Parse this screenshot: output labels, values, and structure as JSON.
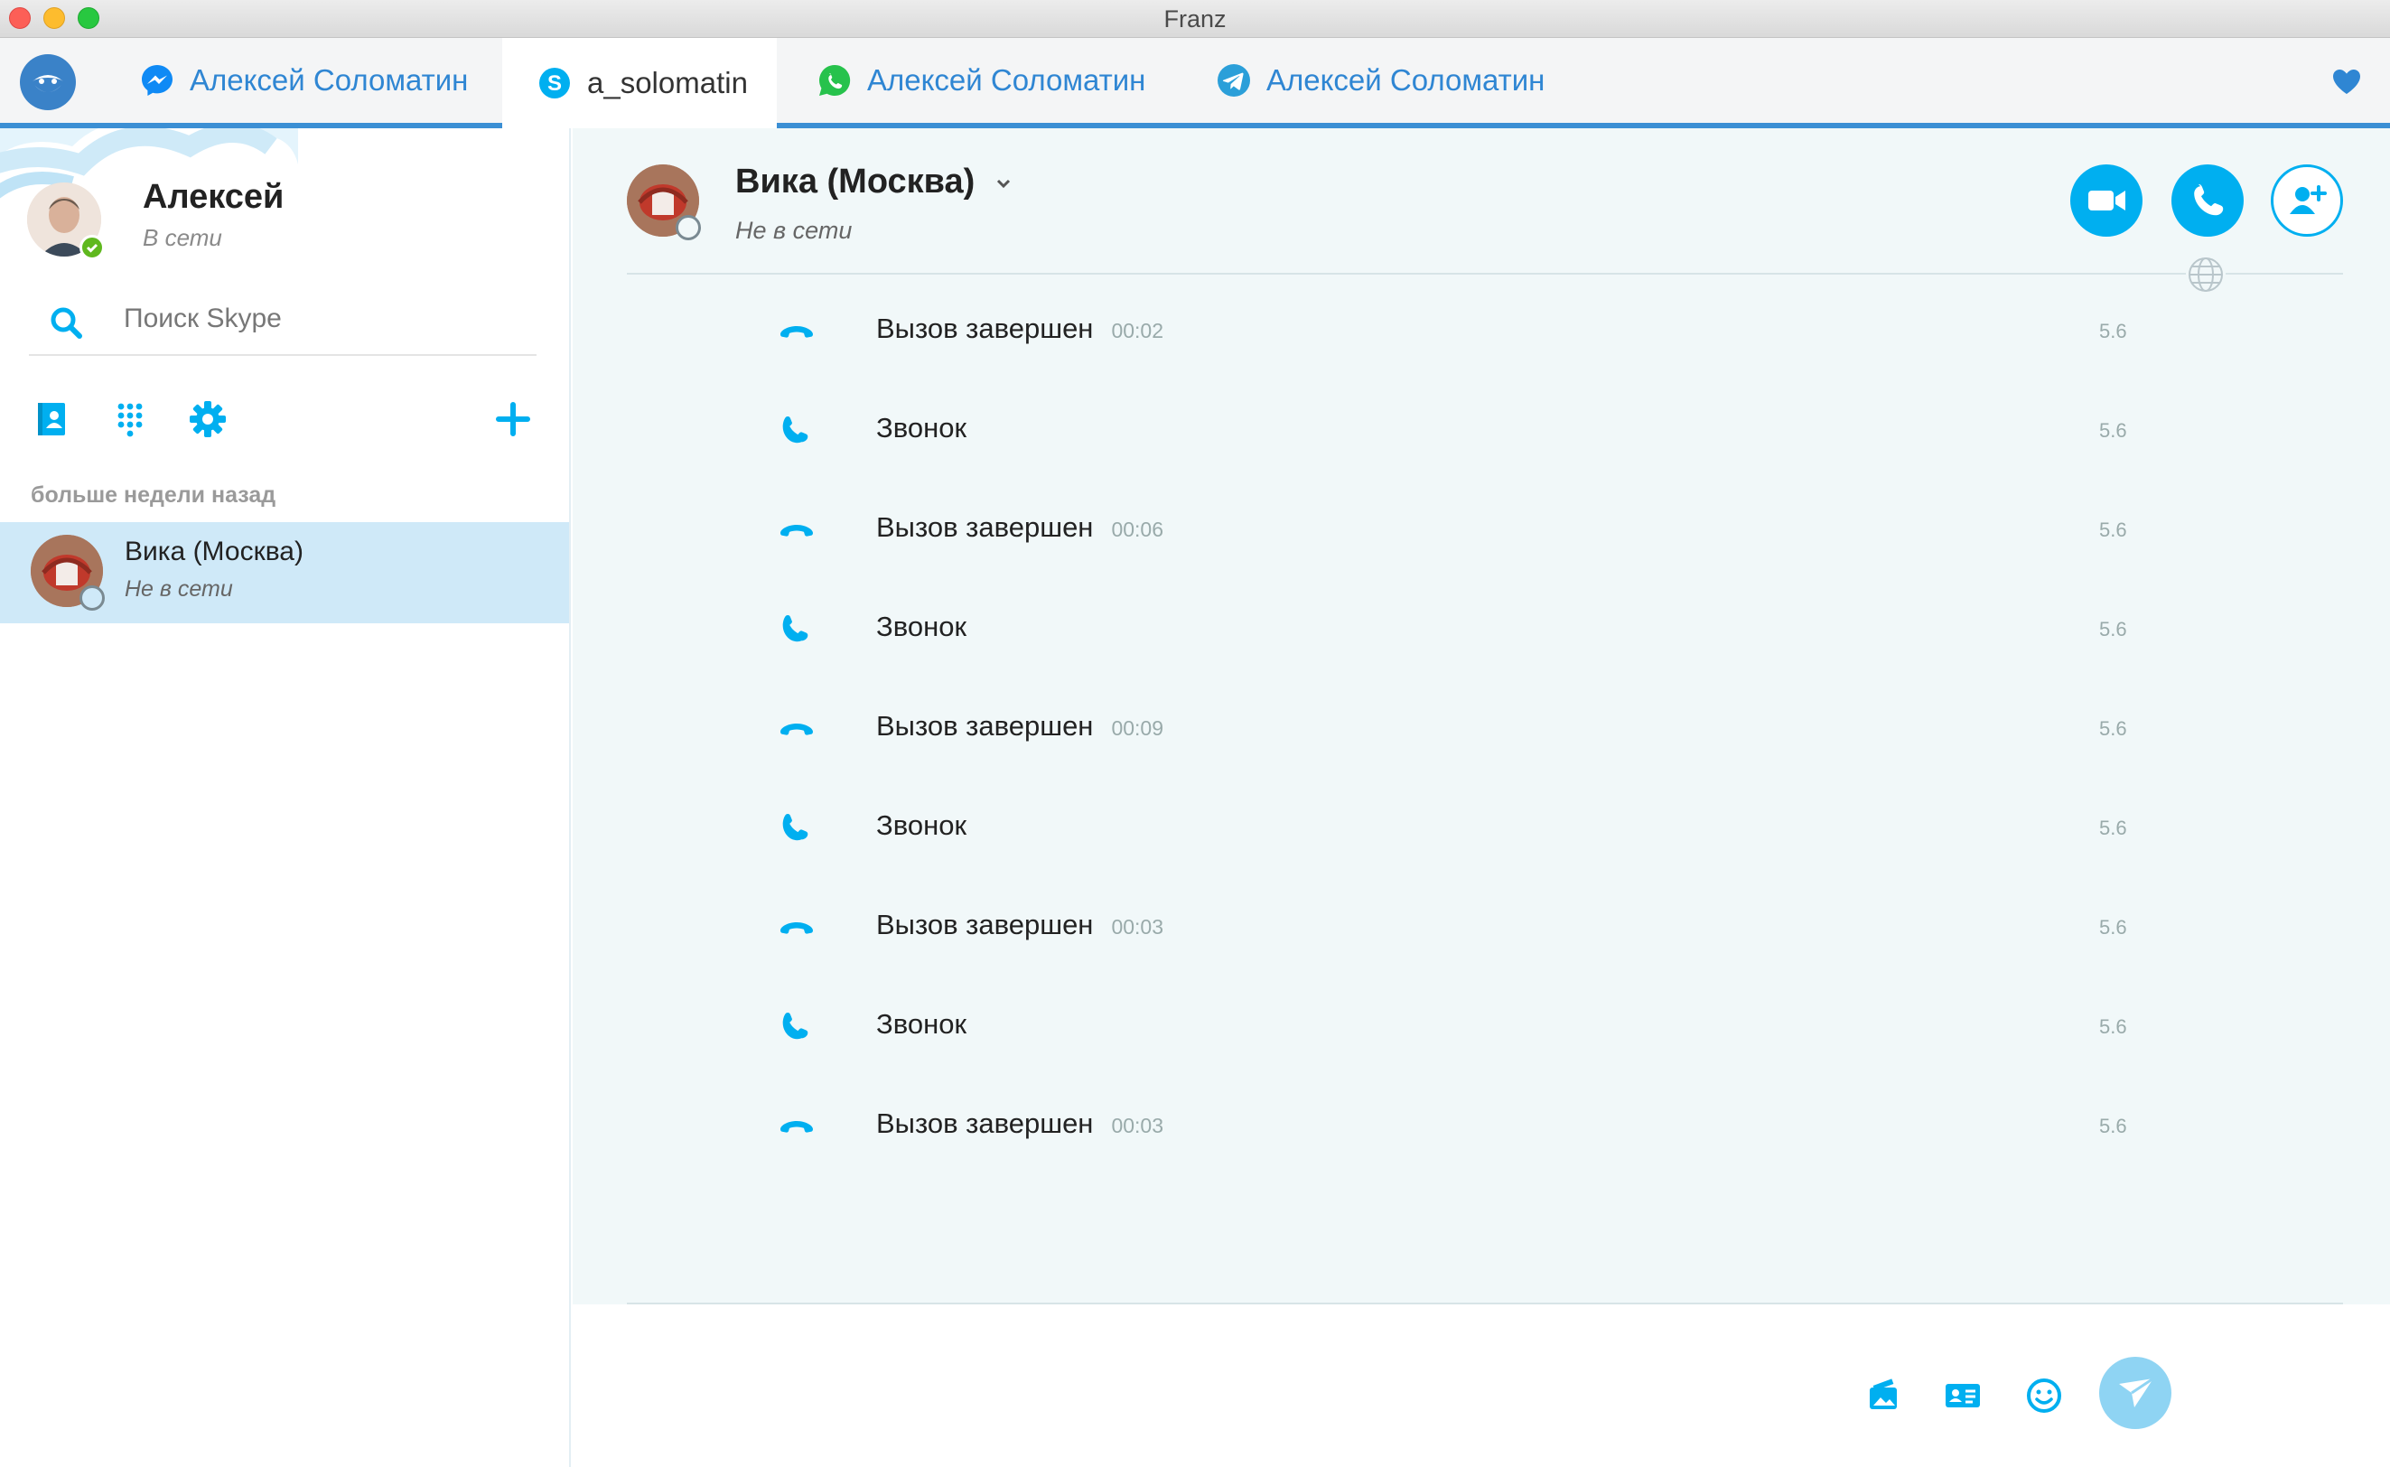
{
  "window": {
    "title": "Franz"
  },
  "colors": {
    "accent": "#00aff0",
    "tab_blue": "#2f86d3",
    "selected_row": "#cfe9f8",
    "online_green": "#5fb81e"
  },
  "tabs": [
    {
      "label": "Алексей Соломатин",
      "icon": "messenger-icon"
    },
    {
      "label": "a_solomatin",
      "icon": "skype-icon"
    },
    {
      "label": "Алексей Соломатин",
      "icon": "whatsapp-icon"
    },
    {
      "label": "Алексей Соломатин",
      "icon": "telegram-icon"
    }
  ],
  "sidebar": {
    "profile": {
      "name": "Алексей",
      "status": "В сети"
    },
    "search": {
      "placeholder": "Поиск Skype"
    },
    "section_label": "больше недели назад",
    "contacts": [
      {
        "name": "Вика (Москва)",
        "status": "Не в сети"
      }
    ]
  },
  "chat": {
    "contact_name": "Вика (Москва)",
    "contact_status": "Не в сети",
    "messages": [
      {
        "type": "ended",
        "text": "Вызов завершен",
        "duration": "00:02",
        "date": "5.6"
      },
      {
        "type": "call",
        "text": "Звонок",
        "duration": "",
        "date": "5.6"
      },
      {
        "type": "ended",
        "text": "Вызов завершен",
        "duration": "00:06",
        "date": "5.6"
      },
      {
        "type": "call",
        "text": "Звонок",
        "duration": "",
        "date": "5.6"
      },
      {
        "type": "ended",
        "text": "Вызов завершен",
        "duration": "00:09",
        "date": "5.6"
      },
      {
        "type": "call",
        "text": "Звонок",
        "duration": "",
        "date": "5.6"
      },
      {
        "type": "ended",
        "text": "Вызов завершен",
        "duration": "00:03",
        "date": "5.6"
      },
      {
        "type": "call",
        "text": "Звонок",
        "duration": "",
        "date": "5.6"
      },
      {
        "type": "ended",
        "text": "Вызов завершен",
        "duration": "00:03",
        "date": "5.6"
      }
    ]
  }
}
